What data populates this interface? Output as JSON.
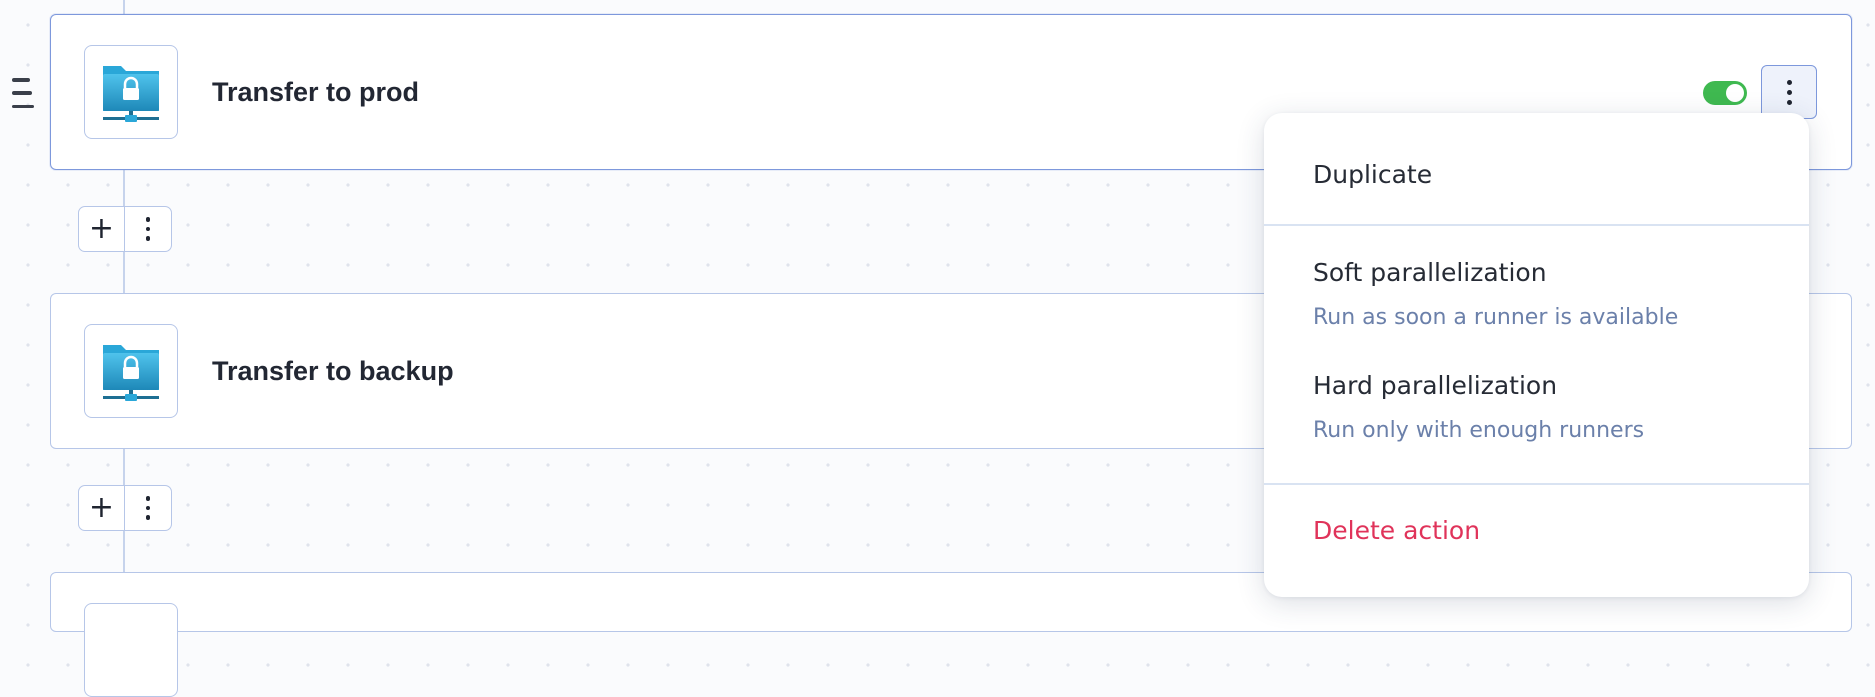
{
  "actions": [
    {
      "title": "Transfer to prod",
      "enabled": true
    },
    {
      "title": "Transfer to backup"
    }
  ],
  "add_group": {
    "add_label": "+"
  },
  "context_menu": {
    "duplicate": "Duplicate",
    "soft_parallelization": "Soft parallelization",
    "soft_parallelization_desc": "Run as soon a runner is available",
    "hard_parallelization": "Hard parallelization",
    "hard_parallelization_desc": "Run only with enough runners",
    "delete": "Delete action"
  },
  "icons": {
    "drag_handle": "drag-handle-icon",
    "action_icon": "sftp-folder-lock-icon",
    "more": "more-vertical-icon",
    "add": "plus-icon"
  },
  "colors": {
    "accent": "#7d98dc",
    "toggle_on": "#3fb950",
    "danger": "#e0335a",
    "muted": "#6b80aa"
  }
}
